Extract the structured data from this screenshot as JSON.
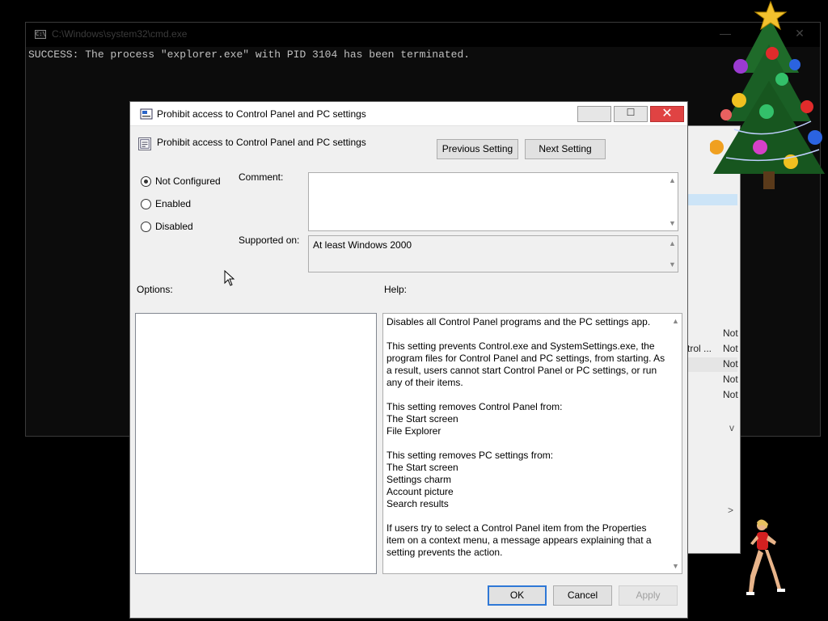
{
  "cmd": {
    "title": "C:\\Windows\\system32\\cmd.exe",
    "output": "SUCCESS: The process \"explorer.exe\" with PID 3104 has been terminated.",
    "minimize": "—",
    "close": "✕"
  },
  "background_window": {
    "row_fragment": "trol ...",
    "values": [
      "Not",
      "Not",
      "Not",
      "Not",
      "Not"
    ],
    "scroll_right": ">",
    "scroll_down": "v"
  },
  "dialog": {
    "title": "Prohibit access to Control Panel and PC settings",
    "header": "Prohibit access to Control Panel and PC settings",
    "prev_button": "Previous Setting",
    "next_button": "Next Setting",
    "radio": {
      "not_configured": "Not Configured",
      "enabled": "Enabled",
      "disabled": "Disabled",
      "selected": "not_configured"
    },
    "comment_label": "Comment:",
    "comment_value": "",
    "supported_label": "Supported on:",
    "supported_value": "At least Windows 2000",
    "options_label": "Options:",
    "help_label": "Help:",
    "help": {
      "p1": "Disables all Control Panel programs and the PC settings app.",
      "p2": "This setting prevents Control.exe and SystemSettings.exe, the program files for Control Panel and PC settings, from starting. As a result, users cannot start Control Panel or PC settings, or run any of their items.",
      "p3_intro": "This setting removes Control Panel from:",
      "p3_items": [
        "The Start screen",
        "File Explorer"
      ],
      "p4_intro": "This setting removes PC settings from:",
      "p4_items": [
        "The Start screen",
        "Settings charm",
        "Account picture",
        "Search results"
      ],
      "p5": "If users try to select a Control Panel item from the Properties item on a context menu, a message appears explaining that a setting prevents the action."
    },
    "ok_button": "OK",
    "cancel_button": "Cancel",
    "apply_button": "Apply",
    "close_glyph": "✕",
    "maximize_glyph": "☐"
  },
  "colors": {
    "accent": "#2f78d6",
    "close_red": "#e04343",
    "console_bg": "#0c0c0c"
  }
}
